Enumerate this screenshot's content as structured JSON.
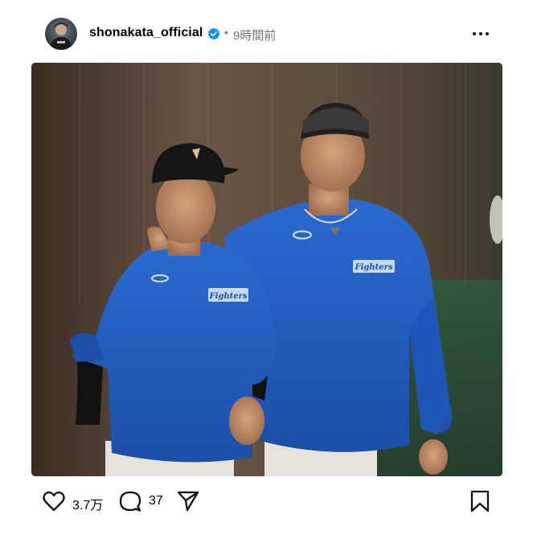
{
  "post": {
    "username": "shonakata_official",
    "separator": "•",
    "time_ago": "9時間前",
    "likes": "3.7万",
    "comments": "37"
  },
  "icons": {
    "verified": "verified-badge-icon",
    "more": "more-options-icon",
    "like": "heart-icon",
    "comment": "comment-bubble-icon",
    "share": "paper-plane-icon",
    "save": "bookmark-icon"
  },
  "colors": {
    "verified": "#0095f6",
    "secondary_text": "#737373",
    "jersey_blue": "#1f5fc4"
  },
  "photo": {
    "jersey_text_left": "Fighters",
    "jersey_text_right": "Fighters"
  }
}
